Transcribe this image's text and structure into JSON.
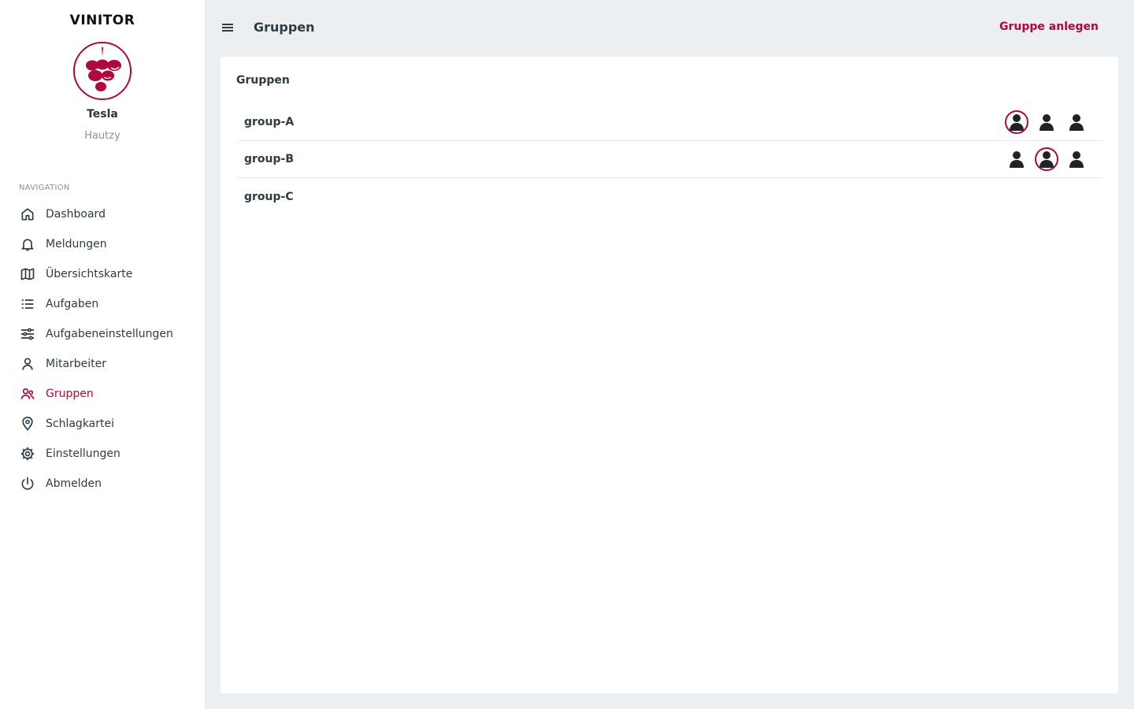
{
  "brand": "VINITOR",
  "user": {
    "name": "Tesla",
    "subtitle": "Hautzy"
  },
  "nav": {
    "heading": "NAVIGATION",
    "items": [
      {
        "label": "Dashboard",
        "icon": "home-icon"
      },
      {
        "label": "Meldungen",
        "icon": "bell-icon"
      },
      {
        "label": "Übersichtskarte",
        "icon": "map-icon"
      },
      {
        "label": "Aufgaben",
        "icon": "list-icon"
      },
      {
        "label": "Aufgabeneinstellungen",
        "icon": "sliders-icon"
      },
      {
        "label": "Mitarbeiter",
        "icon": "user-icon"
      },
      {
        "label": "Gruppen",
        "icon": "users-icon",
        "active": true
      },
      {
        "label": "Schlagkartei",
        "icon": "map-pin-icon"
      },
      {
        "label": "Einstellungen",
        "icon": "gear-icon"
      },
      {
        "label": "Abmelden",
        "icon": "power-icon"
      }
    ]
  },
  "header": {
    "title": "Gruppen",
    "create_label": "Gruppe anlegen"
  },
  "card": {
    "title": "Gruppen",
    "groups": [
      {
        "name": "group-A",
        "avatars": [
          {
            "highlight": true
          },
          {
            "highlight": false
          },
          {
            "highlight": false
          }
        ]
      },
      {
        "name": "group-B",
        "avatars": [
          {
            "highlight": false
          },
          {
            "highlight": true
          },
          {
            "highlight": false
          }
        ]
      },
      {
        "name": "group-C",
        "avatars": []
      }
    ]
  },
  "colors": {
    "accent": "#b0083c",
    "background": "#eceff2",
    "text": "#2d3b45"
  }
}
